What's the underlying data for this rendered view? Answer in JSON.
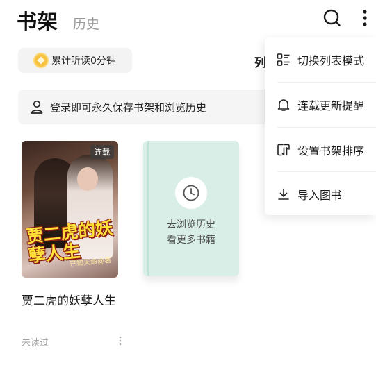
{
  "header": {
    "tab_bookshelf": "书架",
    "tab_history": "历史",
    "search_icon": "search-icon",
    "more_icon": "more-vertical-icon"
  },
  "reading": {
    "listen_text": "累计听读0分钟",
    "coin_icon": "coin-icon",
    "list_mode_partial": "列"
  },
  "login_bar": {
    "icon": "user-icon",
    "text": "登录即可永久保存书架和浏览历史"
  },
  "books": [
    {
      "title": "贾二虎的妖孽人生",
      "status": "未读过",
      "badge": "连载",
      "cover_title": "贾二虎的妖孽人生",
      "cover_author": "已知天命@著"
    }
  ],
  "history_card": {
    "line1": "去浏览历史",
    "line2": "看更多书籍",
    "icon": "clock-icon"
  },
  "menu": {
    "items": [
      {
        "label": "切换列表模式",
        "icon": "list-mode-icon"
      },
      {
        "label": "连载更新提醒",
        "icon": "bell-icon"
      },
      {
        "label": "设置书架排序",
        "icon": "sort-icon"
      },
      {
        "label": "导入图书",
        "icon": "download-icon"
      }
    ]
  },
  "colors": {
    "accent_coin": "#f7c242",
    "history_card_bg": "#d8eee6",
    "cover_title": "#ffe13a"
  }
}
